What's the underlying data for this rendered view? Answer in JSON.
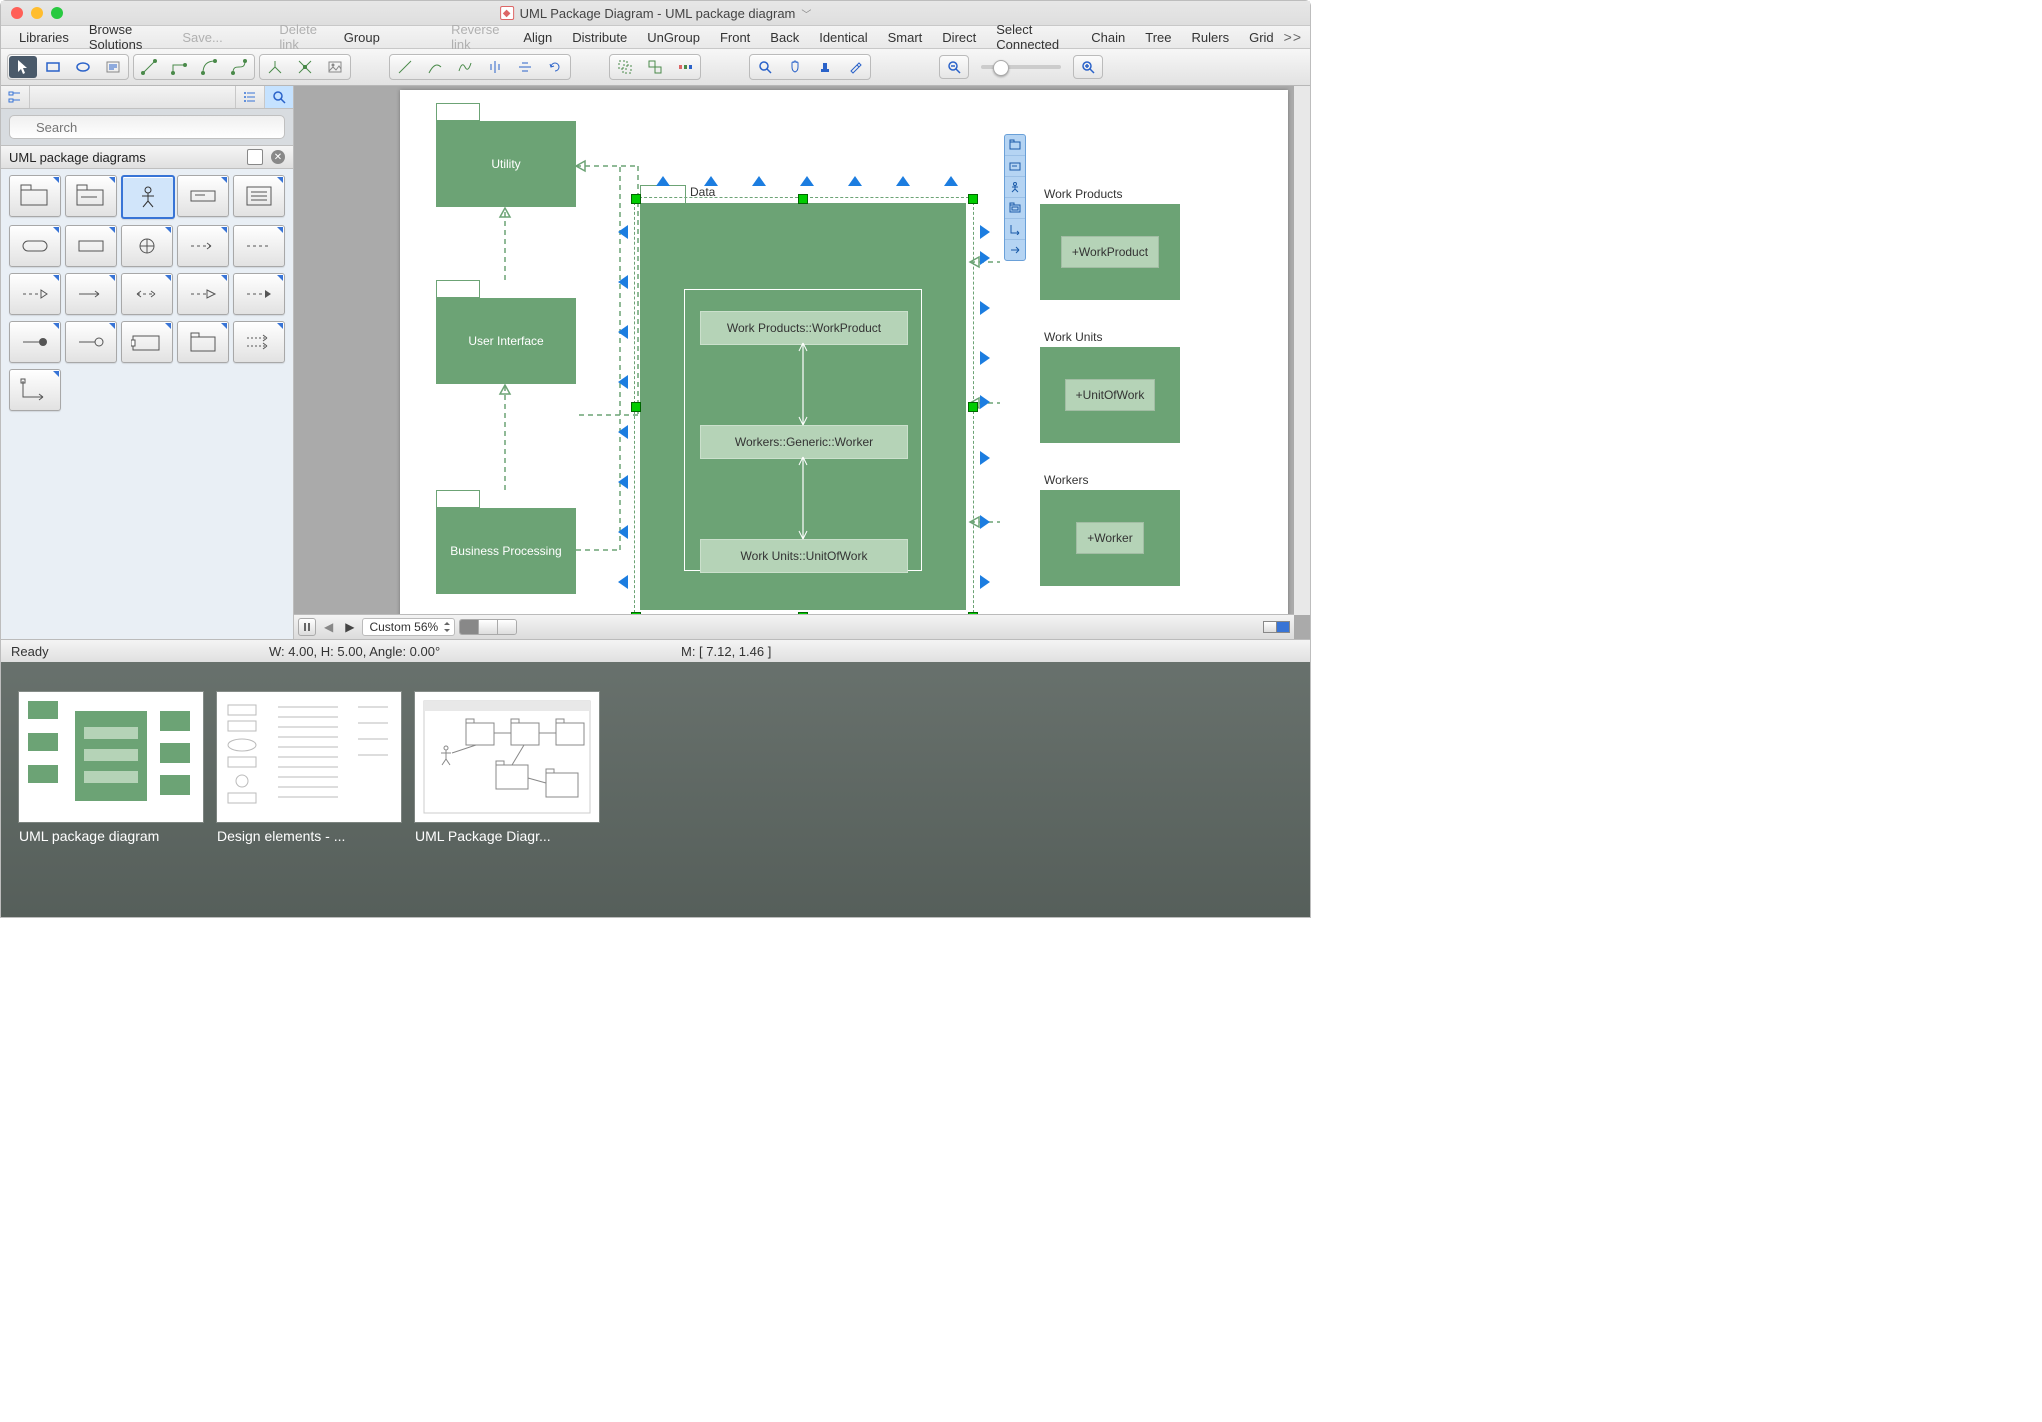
{
  "window": {
    "title": "UML Package Diagram - UML package diagram"
  },
  "menu": {
    "libraries": "Libraries",
    "browse": "Browse Solutions",
    "save": "Save...",
    "delete_link": "Delete link",
    "group": "Group",
    "reverse_link": "Reverse link",
    "align": "Align",
    "distribute": "Distribute",
    "ungroup": "UnGroup",
    "front": "Front",
    "back": "Back",
    "identical": "Identical",
    "smart": "Smart",
    "direct": "Direct",
    "select_connected": "Select Connected",
    "chain": "Chain",
    "tree": "Tree",
    "rulers": "Rulers",
    "grid": "Grid"
  },
  "sidebar": {
    "search_placeholder": "Search",
    "library_title": "UML package diagrams"
  },
  "canvas": {
    "packages": {
      "utility": "Utility",
      "user_interface": "User Interface",
      "business_processing": "Business Processing",
      "data_tab": "Data",
      "data_inner1": "Work Products::WorkProduct",
      "data_inner2": "Workers::Generic::Worker",
      "data_inner3": "Work Units::UnitOfWork",
      "work_products_tab": "Work Products",
      "work_products_inner": "+WorkProduct",
      "work_units_tab": "Work Units",
      "work_units_inner": "+UnitOfWork",
      "workers_tab": "Workers",
      "workers_inner": "+Worker"
    },
    "zoom": "Custom 56%"
  },
  "status": {
    "ready": "Ready",
    "dims": "W: 4.00,  H: 5.00,  Angle: 0.00°",
    "mouse": "M: [ 7.12, 1.46 ]"
  },
  "thumbs": [
    {
      "caption": "UML package diagram"
    },
    {
      "caption": "Design elements - ..."
    },
    {
      "caption": "UML Package Diagr..."
    }
  ]
}
